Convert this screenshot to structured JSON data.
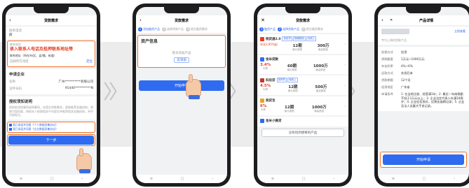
{
  "nav": {
    "home": "≡",
    "square": "□",
    "back": "‹"
  },
  "s1": {
    "title": "贷款需求",
    "contact_header": "联系电话",
    "contact_value": "薛",
    "red_text": "录入联系人电话及抵押联系地址等",
    "address_label": "联系地址（所在市/区、县/镇、街道）",
    "address_placeholder": "选择所在地区",
    "locate": "定位",
    "company_header": "申请企业",
    "company_name_label": "名称",
    "company_name_value": "广州**********有限公司",
    "company_code_label": "证件号码",
    "company_code_value": "91440**********N",
    "note_header": "授权须知说明",
    "note_text": "授权前须知事项说明事项，在提交贷款需求，获取推荐金融机构，则视为您同意，授权本人依照相关平台提交并推荐相关金融机构，并作为授权方。",
    "agree1": "我已阅读并同意《个人数据采集协议》",
    "agree2": "我已阅读并同意《企业数据采集协议》",
    "next": "下一步"
  },
  "s2": {
    "title": "贷款需求",
    "steps": [
      {
        "num": "1",
        "label": "添加融资产品"
      },
      {
        "num": "2",
        "label": "选择贷款产品"
      },
      {
        "num": "3",
        "label": "提交融资需求"
      }
    ],
    "section": "资产信息",
    "empty": "暂未添加产品",
    "add": "去添加",
    "start": "开始申请"
  },
  "s3": {
    "title": "贷款需求",
    "steps": [
      {
        "num": "1",
        "label": "融资产品"
      },
      {
        "num": "2",
        "label": "选择贷款产品"
      },
      {
        "num": "3",
        "label": "提交融资需求"
      }
    ],
    "products": [
      {
        "name": "税贷通2.0",
        "tags": [
          "信用贷",
          "随借随还",
          "纯线上"
        ],
        "rate": "年化3.85%起",
        "term": "12期",
        "term_cap": "最长期限",
        "amount": "300万",
        "amount_cap": "最高额度",
        "color": "#e53c20"
      },
      {
        "name": "金米贷款",
        "tags": [],
        "rate": "3.4%",
        "rate_cap": "利率",
        "term": "60期",
        "term_cap": "最长期限",
        "amount": "1000万",
        "amount_cap": "最高额度",
        "color": "#2e6bf0"
      },
      {
        "name": "科技贷",
        "tags": [
          "抵押贷",
          "纯线上"
        ],
        "rate": "4.5%",
        "rate_cap": "利率",
        "term": "12期",
        "term_cap": "最长期限",
        "amount": "500万",
        "amount_cap": "最高额度",
        "color": "#c0392b"
      },
      {
        "name": "税贷宝",
        "tags": [],
        "rate": "6%",
        "rate_cap": "利率",
        "term": "12期",
        "term_cap": "最长期限",
        "amount": "1000万",
        "amount_cap": "最高额度",
        "color": "#f0a020"
      },
      {
        "name": "金米小微贷",
        "tags": [],
        "color": "#2e6bf0"
      }
    ],
    "more": "没有找到想要的产品"
  },
  "s4": {
    "title": "产品详情",
    "link": "立即查看",
    "subtitle": "专为上线的贷款产品",
    "rows": [
      {
        "k": "担保方式",
        "v": "信用"
      },
      {
        "k": "贷款额度",
        "v": "1万元~1000万元"
      },
      {
        "k": "年化利率",
        "v": "4%~6%"
      },
      {
        "k": "还款方式",
        "v": "先息后本"
      },
      {
        "k": "贷款期限",
        "v": "12个月"
      },
      {
        "k": "适用地区",
        "v": "广东省"
      },
      {
        "k": "申请条件",
        "v": "1. 在当地注册、经营满1年；2. 最近一年纳税额不低于1万元以上；3. 企业法定代表人年满18周岁；4. 企业征信良好，近期无逾期记录；5. 企业及法人无重大不良记录。"
      }
    ],
    "start": "开始申请"
  }
}
